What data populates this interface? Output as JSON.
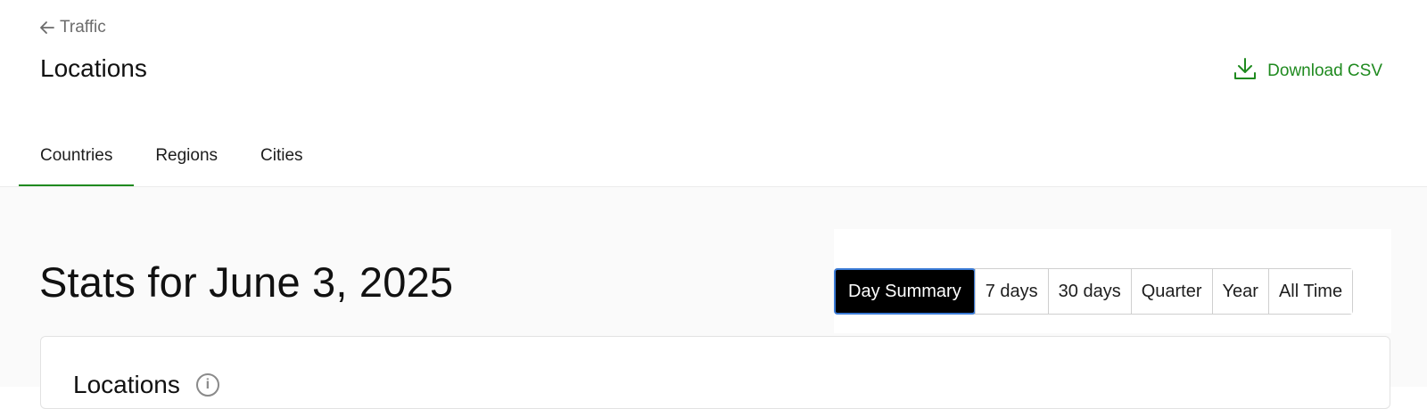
{
  "header": {
    "back_label": "Traffic",
    "title": "Locations",
    "download_label": "Download CSV"
  },
  "tabs": [
    {
      "label": "Countries",
      "active": true
    },
    {
      "label": "Regions",
      "active": false
    },
    {
      "label": "Cities",
      "active": false
    }
  ],
  "main": {
    "stats_title": "Stats for June 3, 2025",
    "ranges": [
      {
        "label": "Day Summary",
        "active": true
      },
      {
        "label": "7 days",
        "active": false
      },
      {
        "label": "30 days",
        "active": false
      },
      {
        "label": "Quarter",
        "active": false
      },
      {
        "label": "Year",
        "active": false
      },
      {
        "label": "All Time",
        "active": false
      }
    ],
    "card_title": "Locations"
  },
  "colors": {
    "accent": "#1f8a1f",
    "active_range_bg": "#000000",
    "active_range_border": "#3b7bd6"
  }
}
